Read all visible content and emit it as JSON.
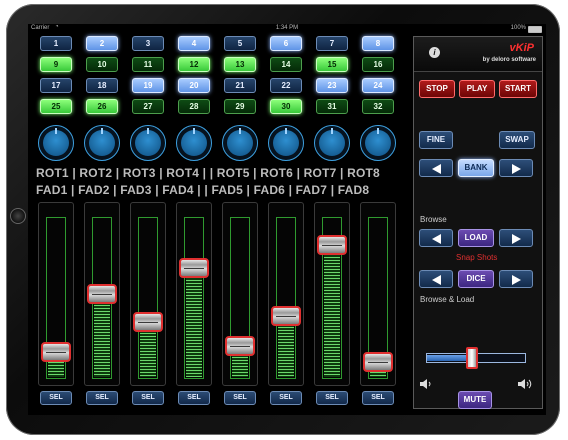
{
  "status": {
    "carrier": "Carrier",
    "time": "1:34 PM",
    "battery": "100%",
    "battery_level": 1.0,
    "wifi_icon": "wifi-icon"
  },
  "grid": [
    {
      "label": "1",
      "color": "blue",
      "lit": false
    },
    {
      "label": "2",
      "color": "blue",
      "lit": true
    },
    {
      "label": "3",
      "color": "blue",
      "lit": false
    },
    {
      "label": "4",
      "color": "blue",
      "lit": true
    },
    {
      "label": "5",
      "color": "blue",
      "lit": false
    },
    {
      "label": "6",
      "color": "blue",
      "lit": true
    },
    {
      "label": "7",
      "color": "blue",
      "lit": false
    },
    {
      "label": "8",
      "color": "blue",
      "lit": true
    },
    {
      "label": "9",
      "color": "green",
      "lit": true
    },
    {
      "label": "10",
      "color": "green",
      "lit": false
    },
    {
      "label": "11",
      "color": "green",
      "lit": false
    },
    {
      "label": "12",
      "color": "green",
      "lit": true
    },
    {
      "label": "13",
      "color": "green",
      "lit": true
    },
    {
      "label": "14",
      "color": "green",
      "lit": false
    },
    {
      "label": "15",
      "color": "green",
      "lit": true
    },
    {
      "label": "16",
      "color": "green",
      "lit": false
    },
    {
      "label": "17",
      "color": "blue",
      "lit": false
    },
    {
      "label": "18",
      "color": "blue",
      "lit": false
    },
    {
      "label": "19",
      "color": "blue",
      "lit": true
    },
    {
      "label": "20",
      "color": "blue",
      "lit": true
    },
    {
      "label": "21",
      "color": "blue",
      "lit": false
    },
    {
      "label": "22",
      "color": "blue",
      "lit": false
    },
    {
      "label": "23",
      "color": "blue",
      "lit": true
    },
    {
      "label": "24",
      "color": "blue",
      "lit": true
    },
    {
      "label": "25",
      "color": "green",
      "lit": true
    },
    {
      "label": "26",
      "color": "green",
      "lit": true
    },
    {
      "label": "27",
      "color": "green",
      "lit": false
    },
    {
      "label": "28",
      "color": "green",
      "lit": false
    },
    {
      "label": "29",
      "color": "green",
      "lit": false
    },
    {
      "label": "30",
      "color": "green",
      "lit": true
    },
    {
      "label": "31",
      "color": "green",
      "lit": false
    },
    {
      "label": "32",
      "color": "green",
      "lit": false
    }
  ],
  "rotary_labels": "ROT1 | ROT2 | ROT3 | ROT4 | | ROT5 | ROT6 | ROT7 | ROT8",
  "fader_labels": "FAD1 | FAD2 | FAD3 | FAD4 | | FAD5 | FAD6 | FAD7 | FAD8",
  "faders": [
    {
      "name": "FAD1",
      "level": 0.12
    },
    {
      "name": "FAD2",
      "level": 0.53
    },
    {
      "name": "FAD3",
      "level": 0.33
    },
    {
      "name": "FAD4",
      "level": 0.71
    },
    {
      "name": "FAD5",
      "level": 0.16
    },
    {
      "name": "FAD6",
      "level": 0.37
    },
    {
      "name": "FAD7",
      "level": 0.87
    },
    {
      "name": "FAD8",
      "level": 0.05
    }
  ],
  "sel_label": "SEL",
  "panel": {
    "info_icon": "info-icon",
    "app_name": "vKiP",
    "app_by": "by deloro software",
    "stop": "STOP",
    "play": "PLAY",
    "start": "START",
    "fine": "FINE",
    "swap": "SWAP",
    "bank": "BANK",
    "browse": "Browse",
    "load": "LOAD",
    "snapshots": "Snap Shots",
    "dice": "DICE",
    "browse_load": "Browse & Load",
    "volume_level": 0.47,
    "mute": "MUTE"
  },
  "colors": {
    "blue_button": "#1f3a5f",
    "blue_lit": "#7aa6ea",
    "green_button": "#0b3f10",
    "green_lit": "#58e050",
    "red_transport": "#b01a1a",
    "accent_red": "#e03030",
    "purple": "#5a3ca0"
  }
}
